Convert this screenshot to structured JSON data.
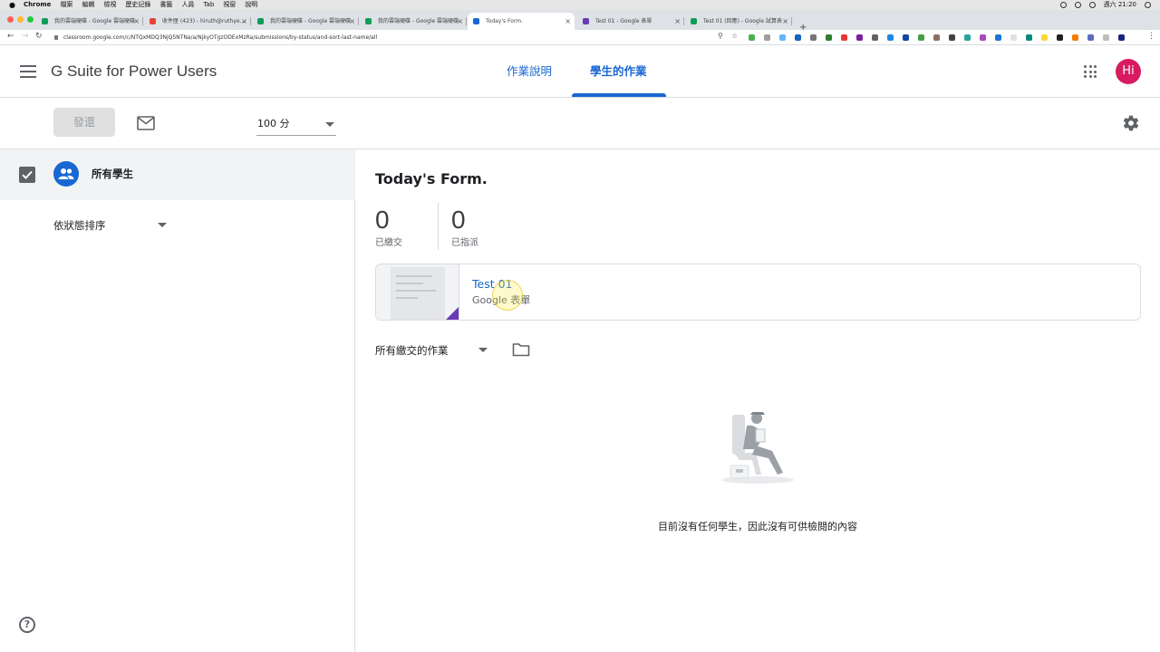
{
  "menubar": {
    "items": [
      "Chrome",
      "檔案",
      "編輯",
      "檢視",
      "歷史記錄",
      "書籤",
      "人員",
      "Tab",
      "視窗",
      "說明"
    ],
    "clock": "週六 21:20"
  },
  "browser": {
    "tabs": [
      {
        "title": "我的雲端硬碟 - Google 雲端硬碟",
        "active": false,
        "favicon_color": "#0f9d58"
      },
      {
        "title": "收件匣 (423) - hiruth@ruthye...",
        "active": false,
        "favicon_color": "#ea4335"
      },
      {
        "title": "我的雲端硬碟 - Google 雲端硬碟",
        "active": false,
        "favicon_color": "#0f9d58"
      },
      {
        "title": "我的雲端硬碟 - Google 雲端硬碟",
        "active": false,
        "favicon_color": "#0f9d58"
      },
      {
        "title": "Today's Form.",
        "active": true,
        "favicon_color": "#1967d2"
      },
      {
        "title": "Test 01 - Google 表單",
        "active": false,
        "favicon_color": "#673ab7"
      },
      {
        "title": "Test 01 (回應) - Google 試算表",
        "active": false,
        "favicon_color": "#0f9d58"
      }
    ],
    "url": "classroom.google.com/c/NTQxMDQ3NjQ5NTNa/a/NjkyOTgzODExMzRa/submissions/by-status/and-sort-last-name/all"
  },
  "header": {
    "course_title": "G Suite for Power Users",
    "tabs": {
      "instructions": "作業說明",
      "student_work": "學生的作業"
    },
    "avatar_initials": "Hi",
    "avatar_color": "#d81b60"
  },
  "toolbar": {
    "return_label": "發還",
    "points_value": "100 分"
  },
  "left_panel": {
    "all_students_label": "所有學生",
    "sort_label": "依狀態排序",
    "help_glyph": "?"
  },
  "main": {
    "assignment_title": "Today's Form.",
    "turned_in_count": "0",
    "turned_in_label": "已繳交",
    "assigned_count": "0",
    "assigned_label": "已指派",
    "attachment": {
      "name": "Test 01",
      "type": "Google 表單"
    },
    "filter_label": "所有繳交的作業",
    "empty_message": "目前沒有任何學生，因此沒有可供檢閱的內容"
  },
  "colors": {
    "accent": "#1967d2",
    "forms": "#673ab7"
  }
}
